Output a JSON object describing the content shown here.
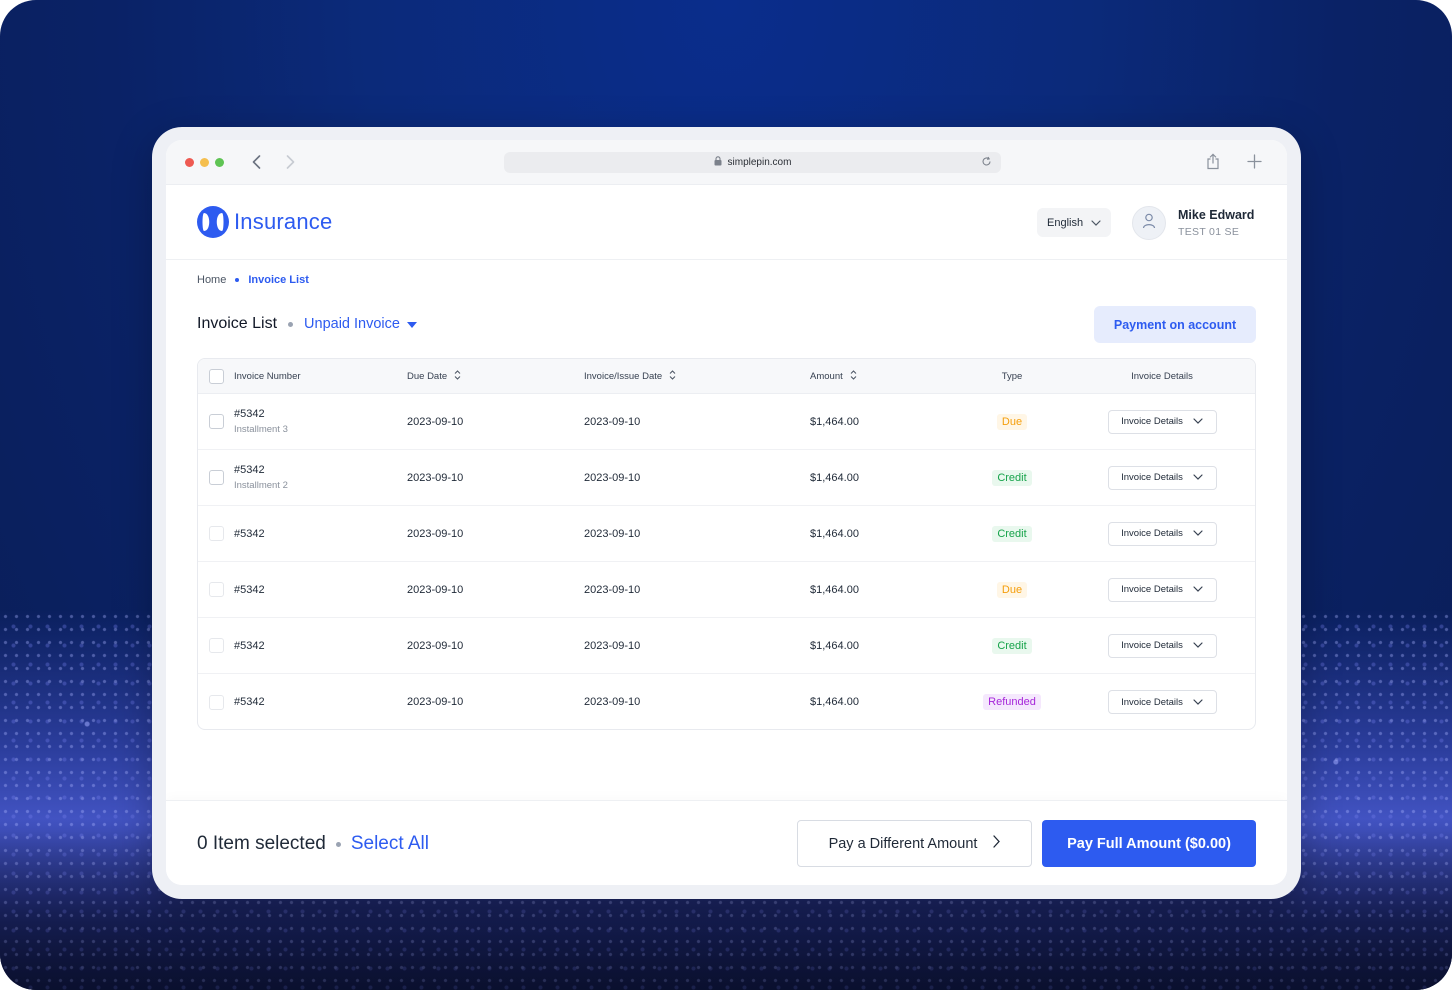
{
  "browser": {
    "url": "simplepin.com"
  },
  "app": {
    "brand": "Insurance",
    "brand_color": "#2d5bf0"
  },
  "header": {
    "language": "English",
    "user_name": "Mike Edward",
    "user_role": "TEST 01 SE"
  },
  "breadcrumb": {
    "home": "Home",
    "current": "Invoice List"
  },
  "page": {
    "title": "Invoice List",
    "filter_label": "Unpaid Invoice",
    "payment_on_account": "Payment on account"
  },
  "table": {
    "columns": [
      "Invoice Number",
      "Due Date",
      "Invoice/Issue Date",
      "Amount",
      "Type",
      "Invoice Details"
    ],
    "rows": [
      {
        "number": "#5342",
        "sub": "Installment 3",
        "due": "2023-09-10",
        "issue": "2023-09-10",
        "amount": "$1,464.00",
        "type": "Due",
        "details": "Invoice Details"
      },
      {
        "number": "#5342",
        "sub": "Installment 2",
        "due": "2023-09-10",
        "issue": "2023-09-10",
        "amount": "$1,464.00",
        "type": "Credit",
        "details": "Invoice Details"
      },
      {
        "number": "#5342",
        "sub": "",
        "due": "2023-09-10",
        "issue": "2023-09-10",
        "amount": "$1,464.00",
        "type": "Credit",
        "details": "Invoice Details"
      },
      {
        "number": "#5342",
        "sub": "",
        "due": "2023-09-10",
        "issue": "2023-09-10",
        "amount": "$1,464.00",
        "type": "Due",
        "details": "Invoice Details"
      },
      {
        "number": "#5342",
        "sub": "",
        "due": "2023-09-10",
        "issue": "2023-09-10",
        "amount": "$1,464.00",
        "type": "Credit",
        "details": "Invoice Details"
      },
      {
        "number": "#5342",
        "sub": "",
        "due": "2023-09-10",
        "issue": "2023-09-10",
        "amount": "$1,464.00",
        "type": "Refunded",
        "details": "Invoice Details"
      }
    ]
  },
  "footer": {
    "selection_count": "0 Item selected",
    "select_all": "Select All",
    "pay_different": "Pay a Different Amount",
    "pay_full": "Pay Full Amount ($0.00)"
  }
}
